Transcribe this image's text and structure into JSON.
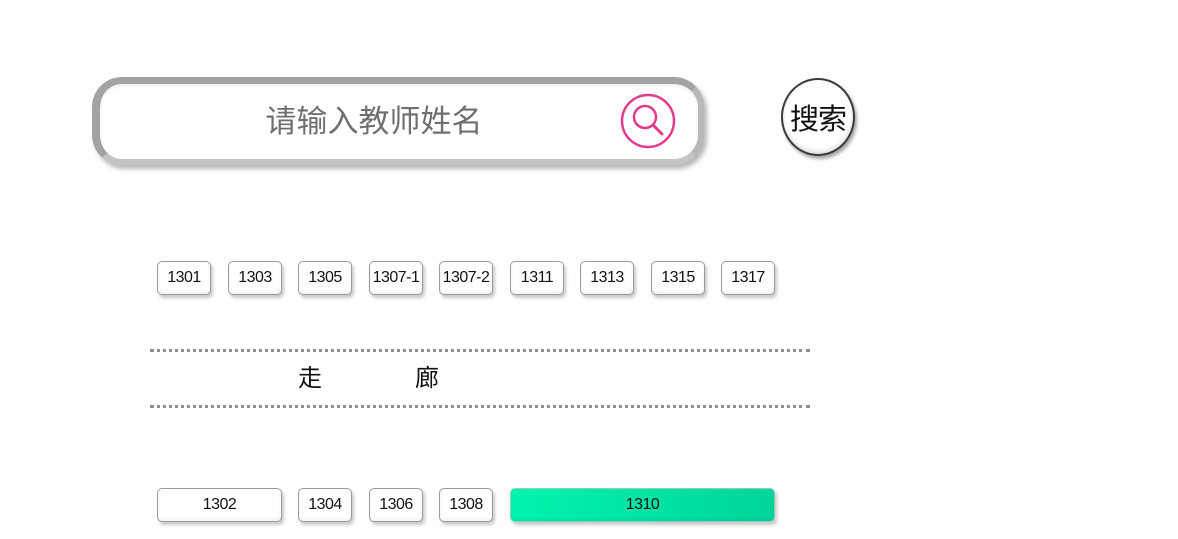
{
  "search": {
    "placeholder": "请输入教师姓名",
    "value": "",
    "button_label": "搜索"
  },
  "rooms_top": [
    "1301",
    "1303",
    "1305",
    "1307-1",
    "1307-2",
    "1311",
    "1313",
    "1315",
    "1317"
  ],
  "corridor": {
    "char1": "走",
    "char2": "廊"
  },
  "rooms_bottom": [
    "1302",
    "1304",
    "1306",
    "1308",
    "1310"
  ],
  "highlighted_room": "1310",
  "colors": {
    "highlight_start": "#00f4ad",
    "highlight_end": "#00d59a",
    "search_icon": "#e03c8a"
  }
}
